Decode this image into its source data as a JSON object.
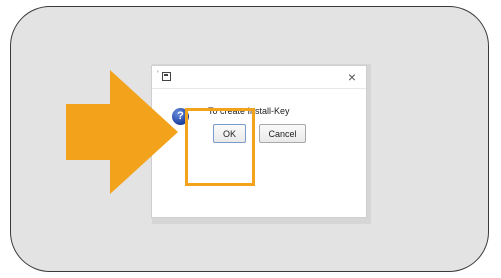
{
  "dialog": {
    "message": "To create Install-Key",
    "ok_label": "OK",
    "cancel_label": "Cancel",
    "close_glyph": "×",
    "help_glyph": "?",
    "title_icon": "window-icon"
  },
  "annotation": {
    "accent_color": "#f2a31b",
    "arrow_icon": "arrow-right-icon",
    "highlight_target": "ok-button"
  },
  "colors": {
    "frame_background": "#e3e3e3",
    "dialog_background": "#ffffff",
    "help_icon": "#1b3f9c"
  }
}
